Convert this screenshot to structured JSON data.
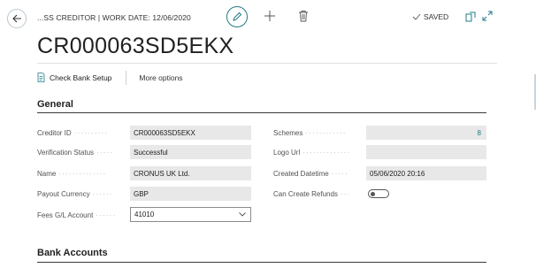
{
  "header": {
    "breadcrumb": "...SS CREDITOR | WORK DATE: 12/06/2020",
    "saved_label": "SAVED",
    "title": "CR000063SD5EKX"
  },
  "actions": {
    "check_bank_setup": "Check Bank Setup",
    "more_options": "More options"
  },
  "general": {
    "section_title": "General",
    "left_fields": [
      {
        "label": "Creditor ID",
        "value": "CR000063SD5EKX"
      },
      {
        "label": "Verification Status",
        "value": "Successful"
      },
      {
        "label": "Name",
        "value": "CRONUS UK Ltd."
      },
      {
        "label": "Payout Currency",
        "value": "GBP"
      },
      {
        "label": "Fees G/L Account",
        "value": "41010"
      }
    ],
    "right_fields": [
      {
        "label": "Schemes",
        "value": "8"
      },
      {
        "label": "Logo Url",
        "value": ""
      },
      {
        "label": "Created Datetime",
        "value": "05/06/2020 20:16"
      },
      {
        "label": "Can Create Refunds",
        "value": ""
      }
    ],
    "can_create_refunds": false
  },
  "bank_accounts": {
    "section_title": "Bank Accounts"
  },
  "colors": {
    "accent": "#1f7b86",
    "field_bg": "#e8e8e8"
  },
  "icons": {
    "back": "back-arrow-icon",
    "edit": "pencil-icon",
    "new": "plus-icon",
    "delete": "trash-icon",
    "saved": "checkmark-icon",
    "open_new": "popout-icon",
    "expand": "expand-icon",
    "check_bank": "document-icon",
    "dropdown": "chevron-down-icon"
  }
}
